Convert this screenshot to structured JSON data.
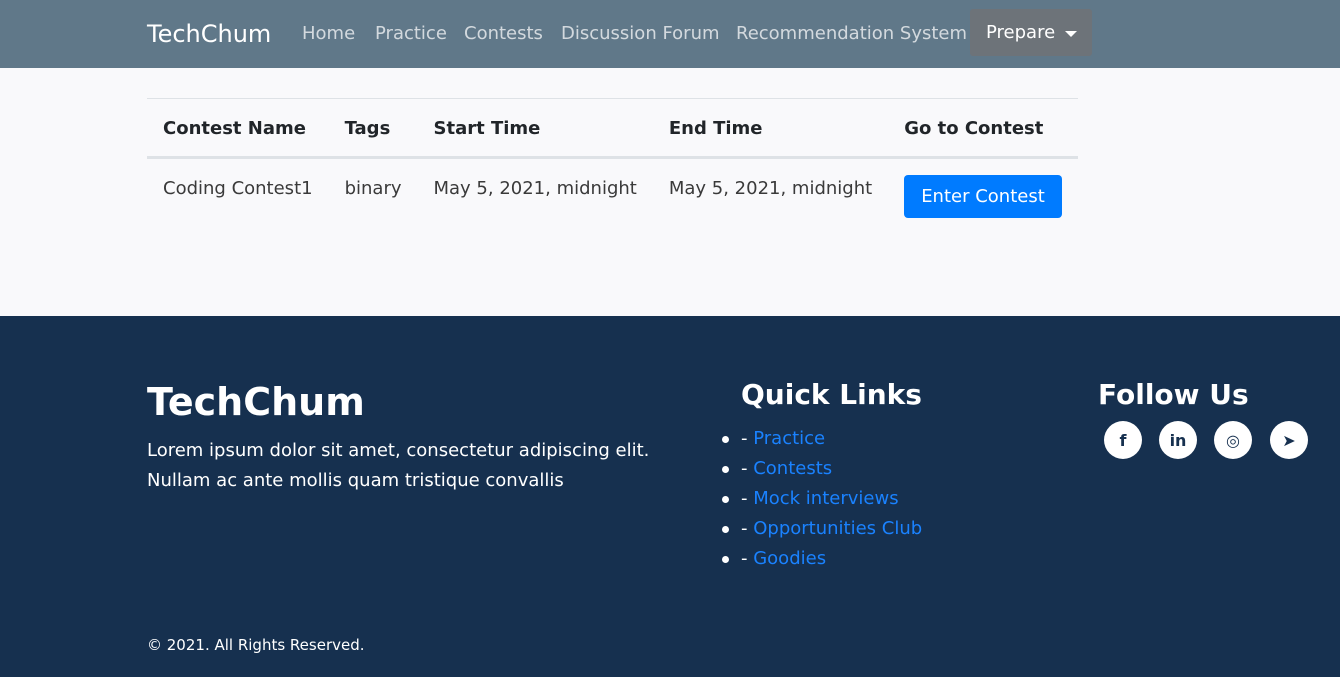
{
  "navbar": {
    "brand": "TechChum",
    "links": [
      "Home",
      "Practice",
      "Contests",
      "Discussion Forum",
      "Recommendation System"
    ],
    "dropdown_label": "Prepare"
  },
  "table": {
    "headers": [
      "Contest Name",
      "Tags",
      "Start Time",
      "End Time",
      "Go to Contest"
    ],
    "rows": [
      {
        "name": "Coding Contest1",
        "tags": "binary",
        "start": "May 5, 2021, midnight",
        "end": "May 5, 2021, midnight",
        "action": "Enter Contest"
      }
    ]
  },
  "footer": {
    "brand": "TechChum",
    "description": "Lorem ipsum dolor sit amet, consectetur adipiscing elit. Nullam ac ante mollis quam tristique convallis",
    "quick_links_title": "Quick Links",
    "link_prefix": "- ",
    "quick_links": [
      "Practice",
      "Contests",
      "Mock interviews",
      "Opportunities Club",
      "Goodies"
    ],
    "follow_title": "Follow Us",
    "social_icons": [
      "facebook-icon",
      "linkedin-icon",
      "instagram-icon",
      "telegram-icon"
    ],
    "social_glyphs": [
      "f",
      "in",
      "◎",
      "➤"
    ],
    "copyright": "© 2021. All Rights Reserved."
  },
  "colors": {
    "navbar_bg": "#607889",
    "button_primary": "#007bff",
    "footer_bg": "#16304f",
    "link": "#1a82ff"
  }
}
